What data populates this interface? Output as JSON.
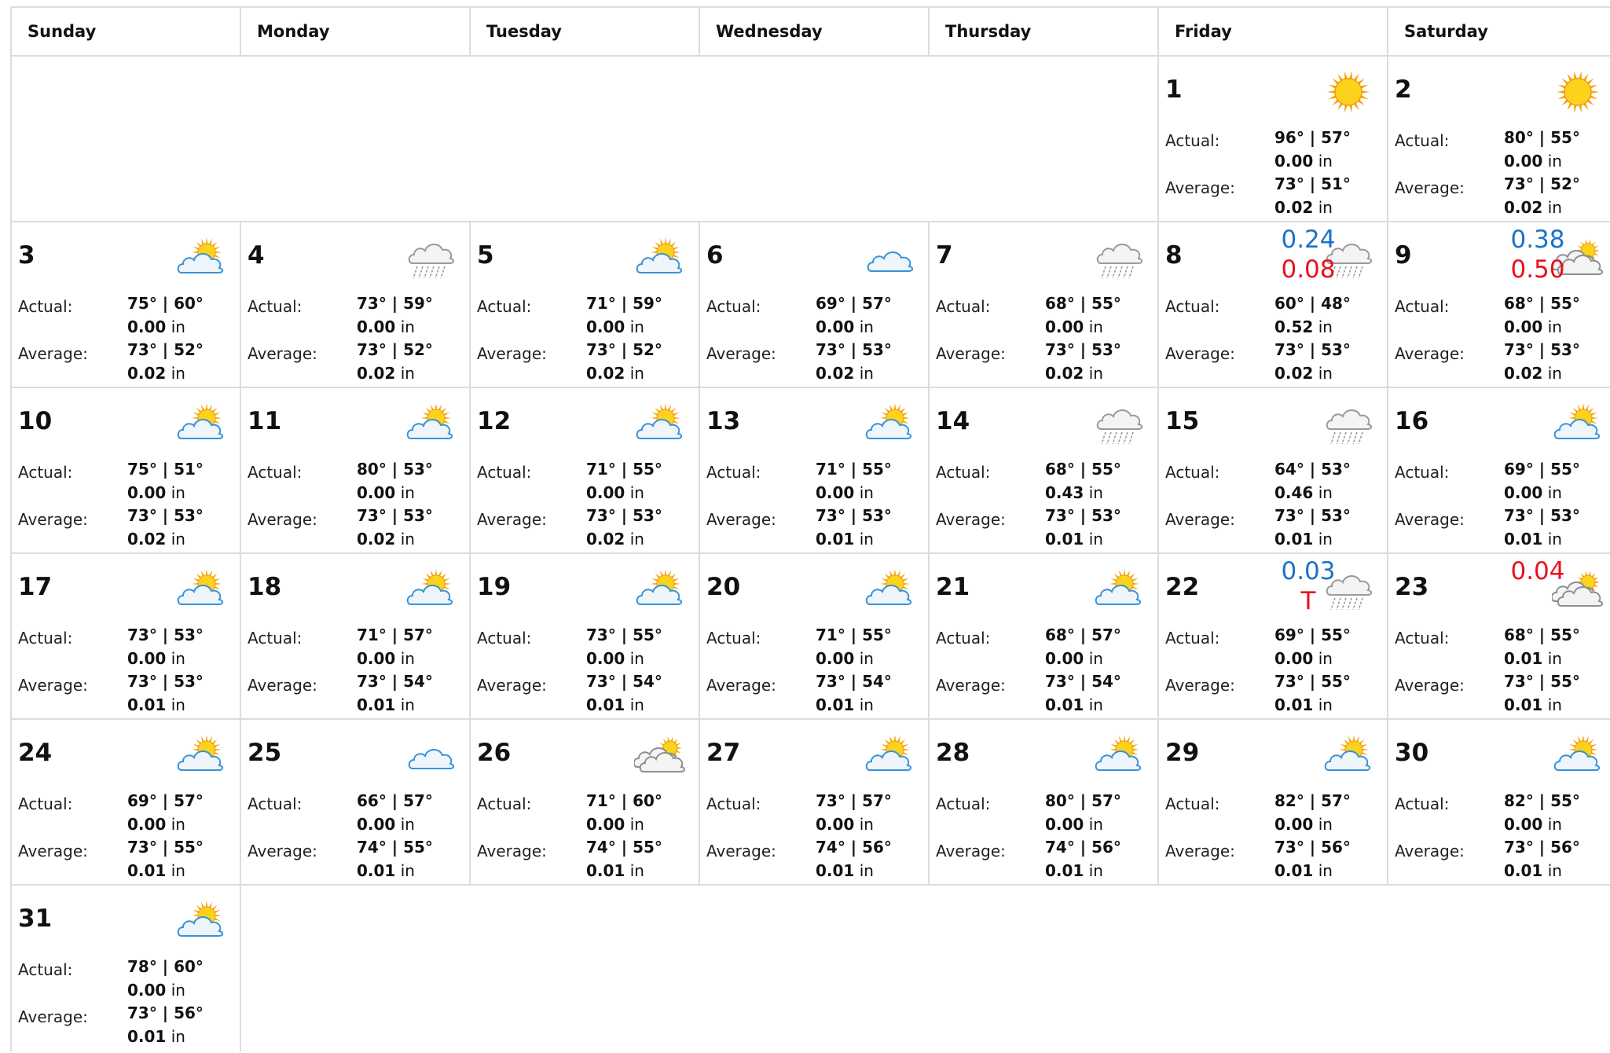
{
  "weekdays": [
    "Sunday",
    "Monday",
    "Tuesday",
    "Wednesday",
    "Thursday",
    "Friday",
    "Saturday"
  ],
  "labels": {
    "actual": "Actual:",
    "average": "Average:",
    "unit": "in"
  },
  "days": [
    {
      "day": "1",
      "icon": "sunny-icon",
      "actual_temp": "96° | 57°",
      "actual_precip": "0.00",
      "avg_temp": "73° | 51°",
      "avg_precip": "0.02"
    },
    {
      "day": "2",
      "icon": "sunny-icon",
      "actual_temp": "80° | 55°",
      "actual_precip": "0.00",
      "avg_temp": "73° | 52°",
      "avg_precip": "0.02"
    },
    {
      "day": "3",
      "icon": "partly-sunny-icon",
      "actual_temp": "75° | 60°",
      "actual_precip": "0.00",
      "avg_temp": "73° | 52°",
      "avg_precip": "0.02"
    },
    {
      "day": "4",
      "icon": "rain-cloud-icon",
      "actual_temp": "73° | 59°",
      "actual_precip": "0.00",
      "avg_temp": "73° | 52°",
      "avg_precip": "0.02"
    },
    {
      "day": "5",
      "icon": "partly-sunny-icon",
      "actual_temp": "71° | 59°",
      "actual_precip": "0.00",
      "avg_temp": "73° | 52°",
      "avg_precip": "0.02"
    },
    {
      "day": "6",
      "icon": "cloud-icon",
      "actual_temp": "69° | 57°",
      "actual_precip": "0.00",
      "avg_temp": "73° | 53°",
      "avg_precip": "0.02"
    },
    {
      "day": "7",
      "icon": "rain-cloud-icon",
      "actual_temp": "68° | 55°",
      "actual_precip": "0.00",
      "avg_temp": "73° | 53°",
      "avg_precip": "0.02"
    },
    {
      "day": "8",
      "icon": "rain-cloud-icon",
      "actual_temp": "60° | 48°",
      "actual_precip": "0.52",
      "avg_temp": "73° | 53°",
      "avg_precip": "0.02",
      "forecast_blue": "0.24",
      "forecast_red": "0.08"
    },
    {
      "day": "9",
      "icon": "overcast-sun-icon",
      "actual_temp": "68° | 55°",
      "actual_precip": "0.00",
      "avg_temp": "73° | 53°",
      "avg_precip": "0.02",
      "forecast_blue": "0.38",
      "forecast_red": "0.50"
    },
    {
      "day": "10",
      "icon": "partly-sunny-icon",
      "actual_temp": "75° | 51°",
      "actual_precip": "0.00",
      "avg_temp": "73° | 53°",
      "avg_precip": "0.02"
    },
    {
      "day": "11",
      "icon": "partly-sunny-icon",
      "actual_temp": "80° | 53°",
      "actual_precip": "0.00",
      "avg_temp": "73° | 53°",
      "avg_precip": "0.02"
    },
    {
      "day": "12",
      "icon": "partly-sunny-icon",
      "actual_temp": "71° | 55°",
      "actual_precip": "0.00",
      "avg_temp": "73° | 53°",
      "avg_precip": "0.02"
    },
    {
      "day": "13",
      "icon": "partly-sunny-icon",
      "actual_temp": "71° | 55°",
      "actual_precip": "0.00",
      "avg_temp": "73° | 53°",
      "avg_precip": "0.01"
    },
    {
      "day": "14",
      "icon": "rain-cloud-icon",
      "actual_temp": "68° | 55°",
      "actual_precip": "0.43",
      "avg_temp": "73° | 53°",
      "avg_precip": "0.01"
    },
    {
      "day": "15",
      "icon": "rain-cloud-icon",
      "actual_temp": "64° | 53°",
      "actual_precip": "0.46",
      "avg_temp": "73° | 53°",
      "avg_precip": "0.01"
    },
    {
      "day": "16",
      "icon": "partly-sunny-icon",
      "actual_temp": "69° | 55°",
      "actual_precip": "0.00",
      "avg_temp": "73° | 53°",
      "avg_precip": "0.01"
    },
    {
      "day": "17",
      "icon": "partly-sunny-icon",
      "actual_temp": "73° | 53°",
      "actual_precip": "0.00",
      "avg_temp": "73° | 53°",
      "avg_precip": "0.01"
    },
    {
      "day": "18",
      "icon": "partly-sunny-icon",
      "actual_temp": "71° | 57°",
      "actual_precip": "0.00",
      "avg_temp": "73° | 54°",
      "avg_precip": "0.01"
    },
    {
      "day": "19",
      "icon": "partly-sunny-icon",
      "actual_temp": "73° | 55°",
      "actual_precip": "0.00",
      "avg_temp": "73° | 54°",
      "avg_precip": "0.01"
    },
    {
      "day": "20",
      "icon": "partly-sunny-icon",
      "actual_temp": "71° | 55°",
      "actual_precip": "0.00",
      "avg_temp": "73° | 54°",
      "avg_precip": "0.01"
    },
    {
      "day": "21",
      "icon": "partly-sunny-icon",
      "actual_temp": "68° | 57°",
      "actual_precip": "0.00",
      "avg_temp": "73° | 54°",
      "avg_precip": "0.01"
    },
    {
      "day": "22",
      "icon": "rain-cloud-icon",
      "actual_temp": "69° | 55°",
      "actual_precip": "0.00",
      "avg_temp": "73° | 55°",
      "avg_precip": "0.01",
      "forecast_blue": "0.03",
      "forecast_red": "T"
    },
    {
      "day": "23",
      "icon": "overcast-sun-icon",
      "actual_temp": "68° | 55°",
      "actual_precip": "0.01",
      "avg_temp": "73° | 55°",
      "avg_precip": "0.01",
      "forecast_red": "0.04"
    },
    {
      "day": "24",
      "icon": "partly-sunny-icon",
      "actual_temp": "69° | 57°",
      "actual_precip": "0.00",
      "avg_temp": "73° | 55°",
      "avg_precip": "0.01"
    },
    {
      "day": "25",
      "icon": "cloud-icon",
      "actual_temp": "66° | 57°",
      "actual_precip": "0.00",
      "avg_temp": "74° | 55°",
      "avg_precip": "0.01"
    },
    {
      "day": "26",
      "icon": "overcast-sun-icon",
      "actual_temp": "71° | 60°",
      "actual_precip": "0.00",
      "avg_temp": "74° | 55°",
      "avg_precip": "0.01"
    },
    {
      "day": "27",
      "icon": "partly-sunny-icon",
      "actual_temp": "73° | 57°",
      "actual_precip": "0.00",
      "avg_temp": "74° | 56°",
      "avg_precip": "0.01"
    },
    {
      "day": "28",
      "icon": "partly-sunny-icon",
      "actual_temp": "80° | 57°",
      "actual_precip": "0.00",
      "avg_temp": "74° | 56°",
      "avg_precip": "0.01"
    },
    {
      "day": "29",
      "icon": "partly-sunny-icon",
      "actual_temp": "82° | 57°",
      "actual_precip": "0.00",
      "avg_temp": "73° | 56°",
      "avg_precip": "0.01"
    },
    {
      "day": "30",
      "icon": "partly-sunny-icon",
      "actual_temp": "82° | 55°",
      "actual_precip": "0.00",
      "avg_temp": "73° | 56°",
      "avg_precip": "0.01"
    },
    {
      "day": "31",
      "icon": "partly-sunny-icon",
      "actual_temp": "78° | 60°",
      "actual_precip": "0.00",
      "avg_temp": "73° | 56°",
      "avg_precip": "0.01"
    }
  ]
}
